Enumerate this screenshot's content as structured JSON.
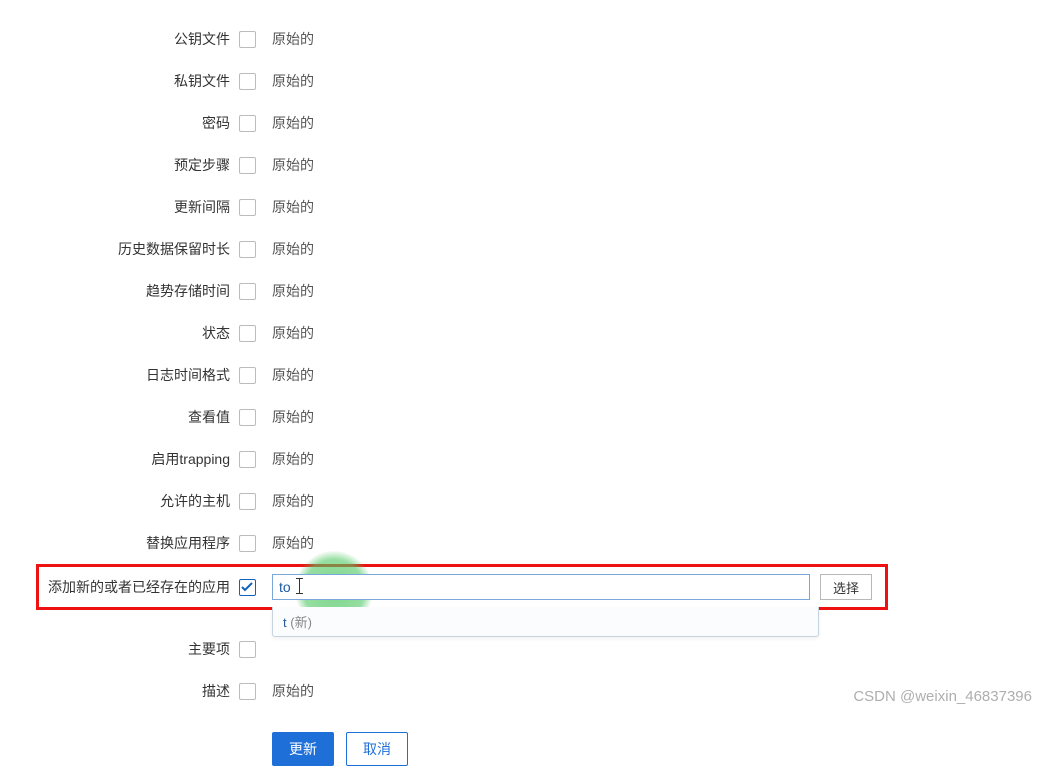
{
  "fields": {
    "public_key_file": {
      "label": "公钥文件",
      "value": "原始的"
    },
    "private_key_file": {
      "label": "私钥文件",
      "value": "原始的"
    },
    "password": {
      "label": "密码",
      "value": "原始的"
    },
    "scheduled_steps": {
      "label": "预定步骤",
      "value": "原始的"
    },
    "update_interval": {
      "label": "更新间隔",
      "value": "原始的"
    },
    "history_retention": {
      "label": "历史数据保留时长",
      "value": "原始的"
    },
    "trend_storage": {
      "label": "趋势存储时间",
      "value": "原始的"
    },
    "status": {
      "label": "状态",
      "value": "原始的"
    },
    "log_time_format": {
      "label": "日志时间格式",
      "value": "原始的"
    },
    "show_value": {
      "label": "查看值",
      "value": "原始的"
    },
    "enable_trapping": {
      "label": "启用trapping",
      "value": "原始的"
    },
    "allowed_hosts": {
      "label": "允许的主机",
      "value": "原始的"
    },
    "replace_app": {
      "label": "替换应用程序",
      "value": "原始的"
    },
    "add_app": {
      "label": "添加新的或者已经存在的应用",
      "input_value": "to",
      "select_btn": "选择"
    },
    "dropdown": {
      "option_text": "t ",
      "option_hint": "(新)"
    },
    "main_item": {
      "label": "主要项"
    },
    "description": {
      "label": "描述",
      "value": "原始的"
    }
  },
  "actions": {
    "update": "更新",
    "cancel": "取消"
  },
  "watermark": "CSDN @weixin_46837396"
}
